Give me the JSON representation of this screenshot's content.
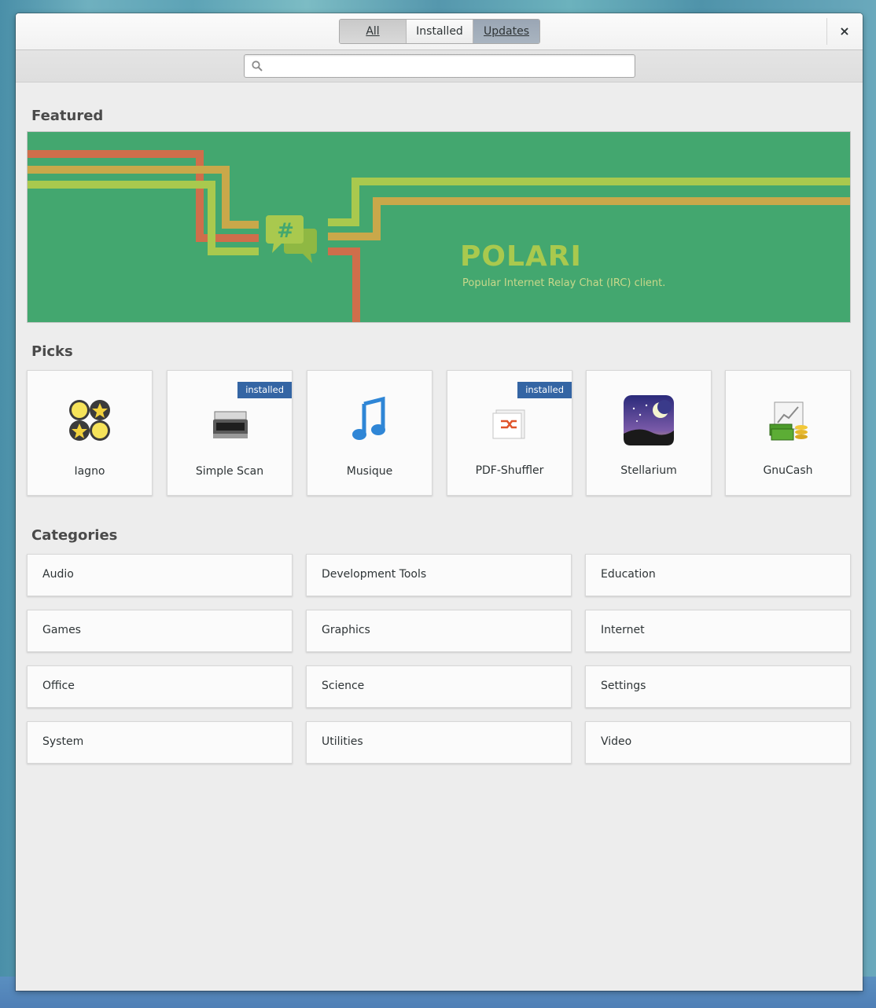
{
  "header": {
    "tabs": [
      {
        "label": "All"
      },
      {
        "label": "Installed"
      },
      {
        "label": "Updates"
      }
    ],
    "close_icon": "×"
  },
  "search": {
    "placeholder": "",
    "value": ""
  },
  "featured": {
    "title": "Featured",
    "app_name": "POLARI",
    "description": "Popular Internet Relay Chat (IRC) client."
  },
  "picks": {
    "title": "Picks",
    "items": [
      {
        "name": "Iagno",
        "icon": "iagno-icon",
        "badge": ""
      },
      {
        "name": "Simple Scan",
        "icon": "scanner-icon",
        "badge": "installed"
      },
      {
        "name": "Musique",
        "icon": "music-note-icon",
        "badge": ""
      },
      {
        "name": "PDF-Shuffler",
        "icon": "pdf-shuffler-icon",
        "badge": "installed"
      },
      {
        "name": "Stellarium",
        "icon": "stellarium-icon",
        "badge": ""
      },
      {
        "name": "GnuCash",
        "icon": "gnucash-icon",
        "badge": ""
      }
    ]
  },
  "categories": {
    "title": "Categories",
    "items": [
      "Audio",
      "Development Tools",
      "Education",
      "Games",
      "Graphics",
      "Internet",
      "Office",
      "Science",
      "Settings",
      "System",
      "Utilities",
      "Video"
    ]
  },
  "colors": {
    "featured_bg": "#43a76f",
    "featured_title": "#a9c94e",
    "badge_bg": "#3465a4",
    "stripe_orange": "#cf6e4b",
    "stripe_gold": "#c9a84a",
    "stripe_lime": "#a9c94e"
  }
}
